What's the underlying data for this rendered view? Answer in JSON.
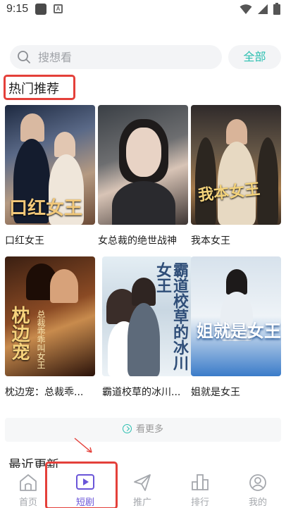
{
  "status_bar": {
    "time": "9:15",
    "icons": [
      "notification-icon",
      "a-icon",
      "wifi-icon",
      "signal-icon",
      "battery-icon"
    ],
    "status_icon_b_letter": "A"
  },
  "search": {
    "placeholder": "搜想看",
    "value": "",
    "all_label": "全部"
  },
  "hot_section": {
    "title": "热门推荐",
    "items": [
      {
        "title": "口红女王",
        "poster_text": "口红女王"
      },
      {
        "title": "女总裁的绝世战神",
        "poster_text": ""
      },
      {
        "title": "我本女王",
        "poster_text": "我本女王"
      },
      {
        "title": "枕边宠：总裁乖...",
        "poster_text": "枕边宠",
        "poster_subtext": "总裁乖乖叫女王"
      },
      {
        "title": "霸道校草的冰川...",
        "poster_text": "霸道校草的冰川女王"
      },
      {
        "title": "姐就是女王",
        "poster_text": "姐就是女王"
      }
    ]
  },
  "see_more_label": "看更多",
  "recent_section": {
    "title": "最近更新"
  },
  "tabs": [
    {
      "label": "首页",
      "icon": "home-icon",
      "active": false
    },
    {
      "label": "短剧",
      "icon": "play-icon",
      "active": true
    },
    {
      "label": "推广",
      "icon": "send-icon",
      "active": false
    },
    {
      "label": "排行",
      "icon": "chart-icon",
      "active": false
    },
    {
      "label": "我的",
      "icon": "profile-icon",
      "active": false
    }
  ],
  "colors": {
    "accent": "#2bbfb0",
    "tab_active": "#6a55d8",
    "annotation": "#e4403a"
  }
}
